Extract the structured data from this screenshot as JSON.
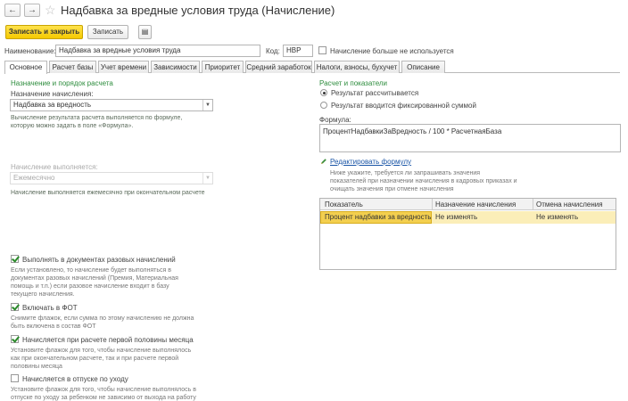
{
  "window": {
    "title": "Надбавка за вредные условия труда (Начисление)"
  },
  "nav": {
    "back": "←",
    "forward": "→",
    "favorite": "☆"
  },
  "toolbar": {
    "save_close": "Записать и закрыть",
    "save": "Записать",
    "more_icon": "▤"
  },
  "header": {
    "name_label": "Наименование:",
    "name_value": "Надбавка за вредные условия труда",
    "code_label": "Код:",
    "code_value": "НВР",
    "unused_label": "Начисление больше не используется"
  },
  "tabs": [
    "Основное",
    "Расчет базы",
    "Учет времени",
    "Зависимости",
    "Приоритет",
    "Средний заработок",
    "Налоги, взносы, бухучет",
    "Описание"
  ],
  "left": {
    "section_title": "Назначение и порядок расчета",
    "purpose_label": "Назначение начисления:",
    "purpose_value": "Надбавка за вредность",
    "purpose_hint_1": "Вычисление результата расчета выполняется по формуле,",
    "purpose_hint_2": "которую можно задать в поле «Формула».",
    "performed_label": "Начисление выполняется:",
    "performed_value": "Ежемесячно",
    "performed_hint": "Начисление выполняется ежемесячно при окончательном расчете",
    "cb1_label": "Выполнять в документах разовых начислений",
    "cb1_hint_1": "Если установлено, то начисление будет выполняться в",
    "cb1_hint_2": "документах разовых начислений (Премия, Материальная",
    "cb1_hint_3": "помощь и т.п.) если разовое начисление входит в базу",
    "cb1_hint_4": "текущего начисления.",
    "cb2_label": "Включать в ФОТ",
    "cb2_hint_1": "Снимите флажок, если сумма по этому начислению не должна",
    "cb2_hint_2": "быть включена в состав ФОТ",
    "cb3_label": "Начисляется при расчете первой половины месяца",
    "cb3_hint_1": "Установите флажок для того, чтобы начисление выполнялось",
    "cb3_hint_2": "как при окончательном расчете, так и при расчете первой",
    "cb3_hint_3": "половины месяца",
    "cb4_label": "Начисляется в отпуске по уходу",
    "cb4_hint_1": "Установите флажок для того, чтобы начисление выполнялось в",
    "cb4_hint_2": "отпуске по уходу за ребенком не зависимо от выхода на работу"
  },
  "right": {
    "section_title": "Расчет и показатели",
    "radio1": "Результат рассчитывается",
    "radio2": "Результат вводится фиксированной суммой",
    "formula_label": "Формула:",
    "formula_value": "ПроцентНадбавкиЗаВредность / 100 * РасчетнаяБаза",
    "edit_formula": "Редактировать формулу",
    "grid_hint_1": "Ниже укажите, требуется ли запрашивать значения",
    "grid_hint_2": "показателей при назначении начисления в кадровых приказах и",
    "grid_hint_3": "очищать значения при отмене начисления",
    "grid": {
      "columns": [
        "Показатель",
        "Назначение начисления",
        "Отмена начисления"
      ],
      "rows": [
        [
          "Процент надбавки за вредность",
          "Не изменять",
          "Не изменять"
        ]
      ]
    }
  }
}
